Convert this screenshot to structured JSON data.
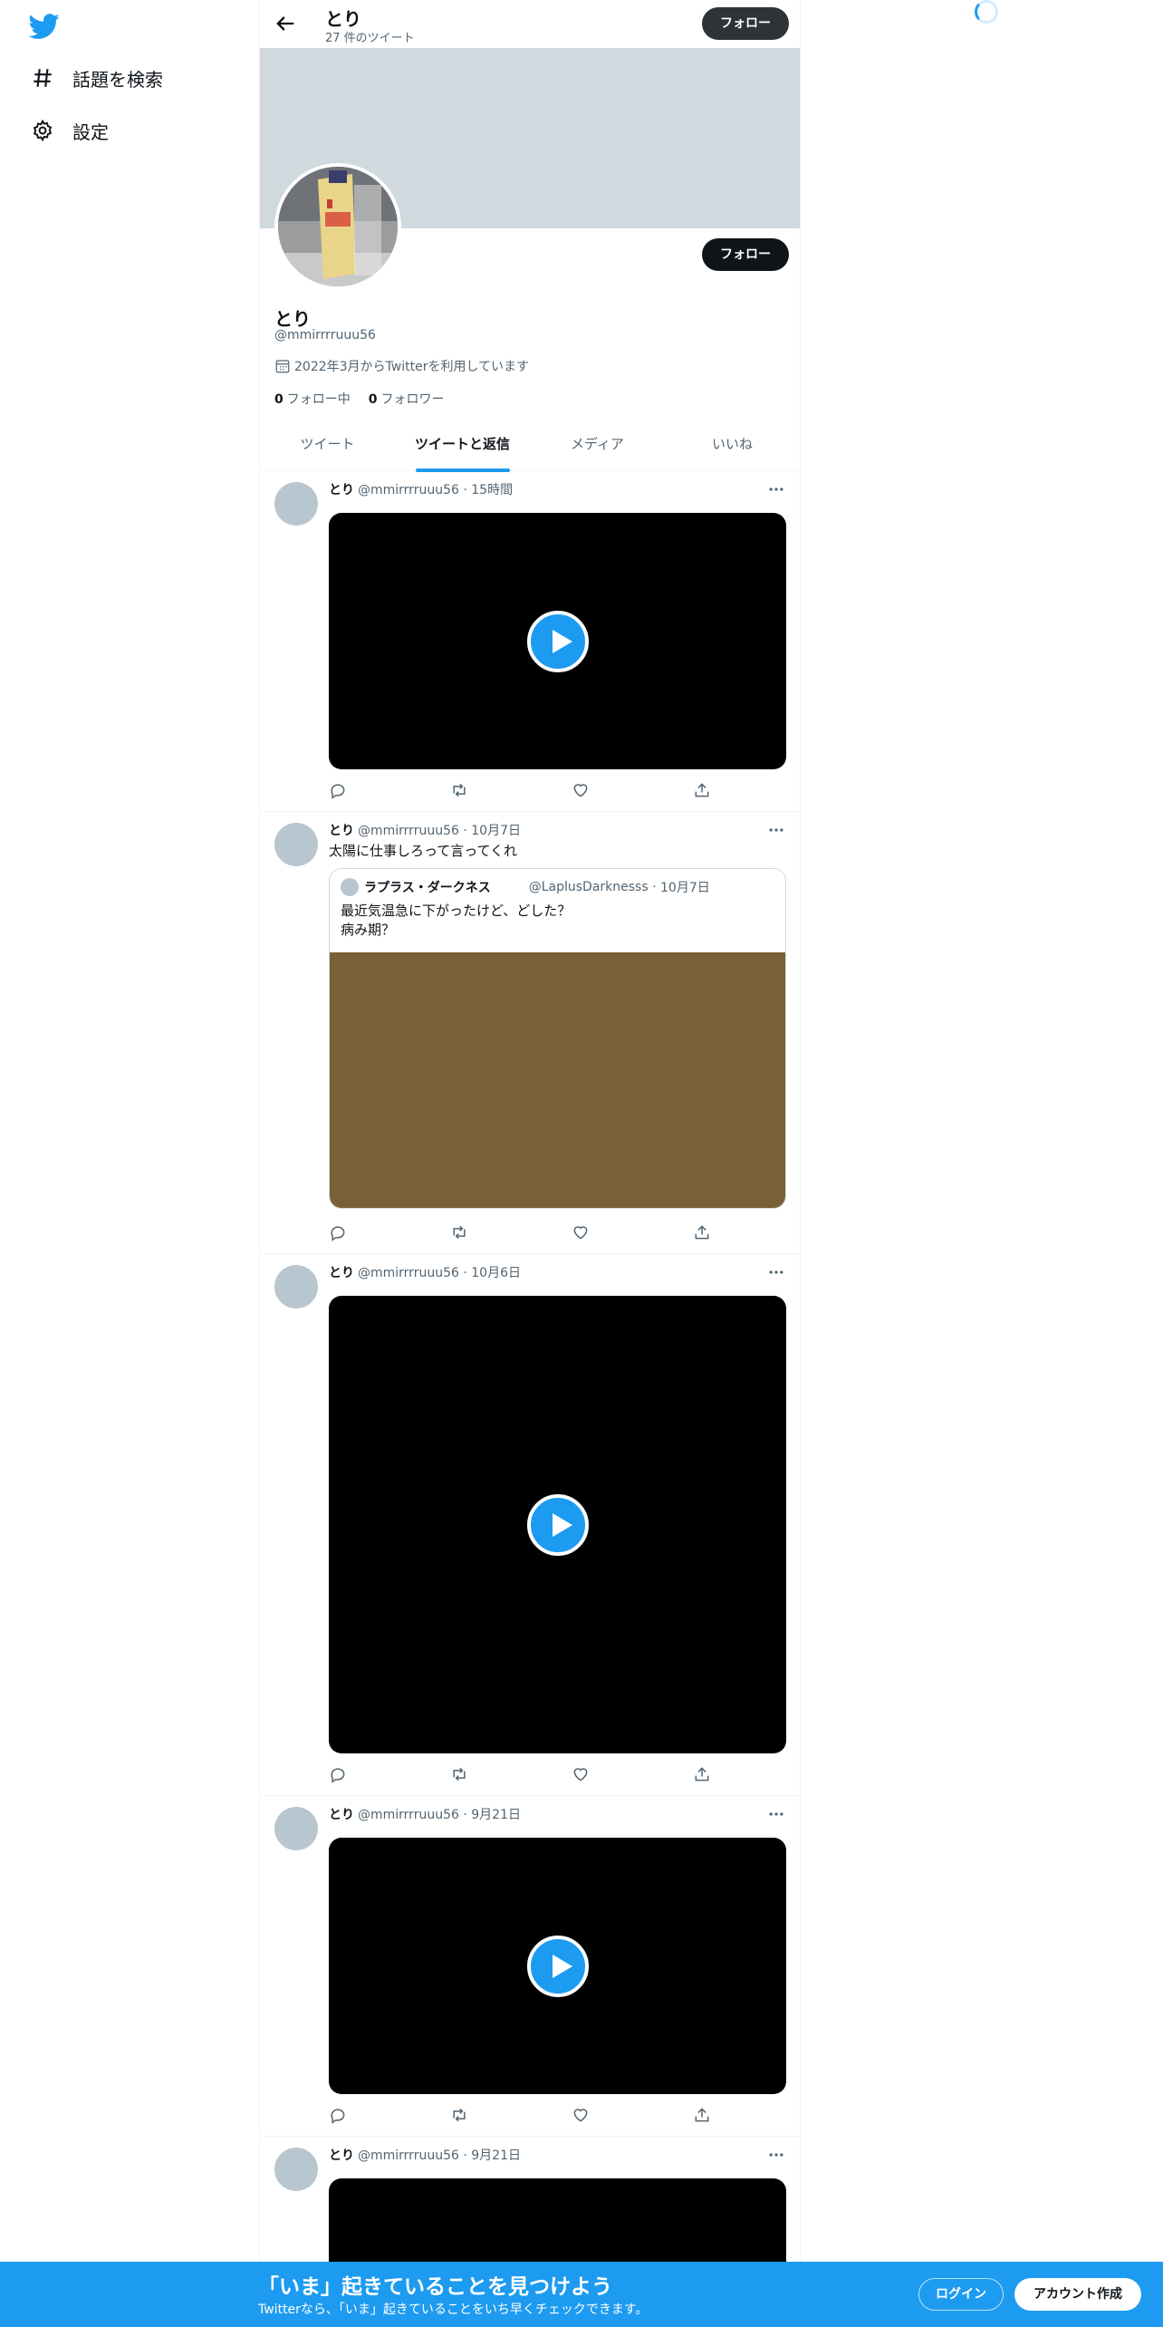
{
  "nav": {
    "explore_label": "話題を検索",
    "settings_label": "設定"
  },
  "header": {
    "name": "とり",
    "tweet_count": "27 件のツイート",
    "follow_label": "フォロー"
  },
  "profile": {
    "name": "とり",
    "handle": "@mmirrrruuu56",
    "joined": "2022年3月からTwitterを利用しています",
    "following_count": "0",
    "following_label": "フォロー中",
    "followers_count": "0",
    "followers_label": "フォロワー",
    "follow_label": "フォロー"
  },
  "tabs": [
    {
      "label": "ツイート"
    },
    {
      "label": "ツイートと返信"
    },
    {
      "label": "メディア"
    },
    {
      "label": "いいね"
    }
  ],
  "tweets": [
    {
      "name": "とり",
      "handle": "@mmirrrruuu56",
      "time": "15時間",
      "text": ""
    },
    {
      "name": "とり",
      "handle": "@mmirrrruuu56",
      "time": "10月7日",
      "text": "太陽に仕事しろって言ってくれ",
      "quote": {
        "name": "ラプラス・ダークネス",
        "handle": "@LaplusDarknesss",
        "time": "10月7日",
        "line1": "最近気温急に下がったけど、どした？",
        "line2": "病み期？"
      }
    },
    {
      "name": "とり",
      "handle": "@mmirrrruuu56",
      "time": "10月6日",
      "text": ""
    },
    {
      "name": "とり",
      "handle": "@mmirrrruuu56",
      "time": "9月21日",
      "text": ""
    },
    {
      "name": "とり",
      "handle": "@mmirrrruuu56",
      "time": "9月21日",
      "text": ""
    }
  ],
  "bottombar": {
    "title": "「いま」起きていることを見つけよう",
    "subtitle": "Twitterなら、「いま」起きていることをいち早くチェックできます。",
    "login_label": "ログイン",
    "signup_label": "アカウント作成"
  },
  "colors": {
    "accent": "#1d9bf0",
    "banner": "#cfd9de",
    "text": "#0f1419",
    "muted": "#536471"
  },
  "icons": [
    "twitter-bird-icon",
    "hashtag-icon",
    "gear-icon",
    "back-arrow-icon",
    "calendar-icon",
    "more-icon",
    "reply-icon",
    "retweet-icon",
    "like-icon",
    "share-icon",
    "play-icon"
  ]
}
